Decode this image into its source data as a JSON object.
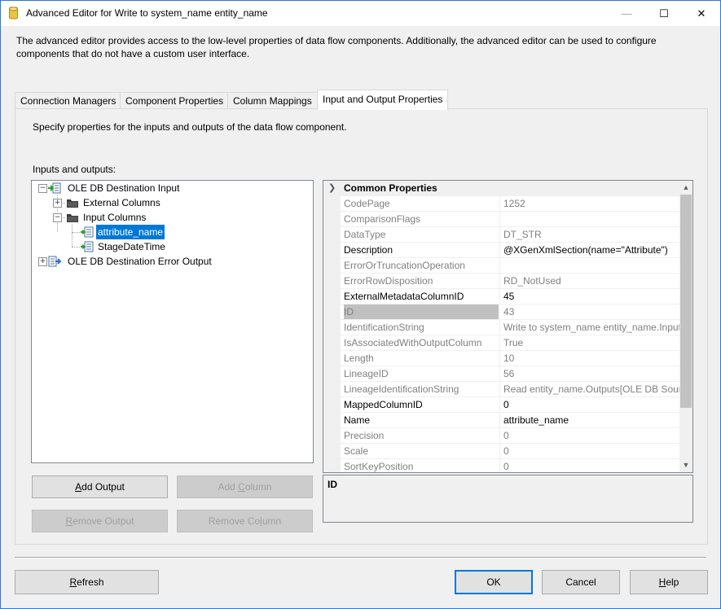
{
  "window": {
    "title": "Advanced Editor for Write to system_name entity_name",
    "minimize": "—",
    "maximize": "☐",
    "close": "✕"
  },
  "description": "The advanced editor provides access to the low-level properties of data flow components. Additionally, the advanced editor can be used to configure components that do not have a custom user interface.",
  "tabs": [
    {
      "label": "Connection Managers",
      "active": false
    },
    {
      "label": "Component Properties",
      "active": false
    },
    {
      "label": "Column Mappings",
      "active": false
    },
    {
      "label": "Input and Output Properties",
      "active": true
    }
  ],
  "panel": {
    "description": "Specify properties for the inputs and outputs of the data flow component.",
    "io_label": "Inputs and outputs:"
  },
  "tree": [
    {
      "label": "OLE DB Destination Input",
      "expander": "−",
      "icon": "input-icon"
    },
    {
      "label": "External Columns",
      "expander": "+",
      "icon": "folder-icon"
    },
    {
      "label": "Input Columns",
      "expander": "−",
      "icon": "folder-icon"
    },
    {
      "label": "attribute_name",
      "icon": "column-icon",
      "selected": true
    },
    {
      "label": "StageDateTime",
      "icon": "column-icon"
    },
    {
      "label": "OLE DB Destination Error Output",
      "expander": "+",
      "icon": "error-output-icon"
    }
  ],
  "left_buttons": {
    "add_output": {
      "pre": "",
      "key": "A",
      "post": "dd Output",
      "enabled": true
    },
    "add_column": {
      "pre": "Add ",
      "key": "C",
      "post": "olumn",
      "enabled": false
    },
    "remove_output": {
      "pre": "",
      "key": "R",
      "post": "emove Output",
      "enabled": false
    },
    "remove_column": {
      "pre": "Remove Co",
      "key": "l",
      "post": "umn",
      "enabled": false
    }
  },
  "properties": {
    "category": "Common Properties",
    "rows": [
      {
        "name": "CodePage",
        "value": "1252",
        "readonly": true
      },
      {
        "name": "ComparisonFlags",
        "value": "",
        "readonly": true
      },
      {
        "name": "DataType",
        "value": "DT_STR",
        "readonly": true
      },
      {
        "name": "Description",
        "value": "@XGenXmlSection(name=\"Attribute\")",
        "readonly": false
      },
      {
        "name": "ErrorOrTruncationOperation",
        "value": "",
        "readonly": true
      },
      {
        "name": "ErrorRowDisposition",
        "value": "RD_NotUsed",
        "readonly": true
      },
      {
        "name": "ExternalMetadataColumnID",
        "value": "45",
        "readonly": false
      },
      {
        "name": "ID",
        "value": "43",
        "readonly": true,
        "selected": true
      },
      {
        "name": "IdentificationString",
        "value": "Write to system_name entity_name.Input",
        "readonly": true
      },
      {
        "name": "IsAssociatedWithOutputColumn",
        "value": "True",
        "readonly": true
      },
      {
        "name": "Length",
        "value": "10",
        "readonly": true
      },
      {
        "name": "LineageID",
        "value": "56",
        "readonly": true
      },
      {
        "name": "LineageIdentificationString",
        "value": "Read entity_name.Outputs[OLE DB Source",
        "readonly": true
      },
      {
        "name": "MappedColumnID",
        "value": "0",
        "readonly": false
      },
      {
        "name": "Name",
        "value": "attribute_name",
        "readonly": false
      },
      {
        "name": "Precision",
        "value": "0",
        "readonly": true
      },
      {
        "name": "Scale",
        "value": "0",
        "readonly": true
      },
      {
        "name": "SortKeyPosition",
        "value": "0",
        "readonly": true
      }
    ],
    "help_title": "ID"
  },
  "footer": {
    "refresh": {
      "pre": "",
      "key": "R",
      "post": "efresh"
    },
    "ok": {
      "pre": "",
      "key": "",
      "post": "OK"
    },
    "cancel": {
      "pre": "",
      "key": "",
      "post": "Cancel"
    },
    "help": {
      "pre": "",
      "key": "H",
      "post": "elp"
    }
  }
}
